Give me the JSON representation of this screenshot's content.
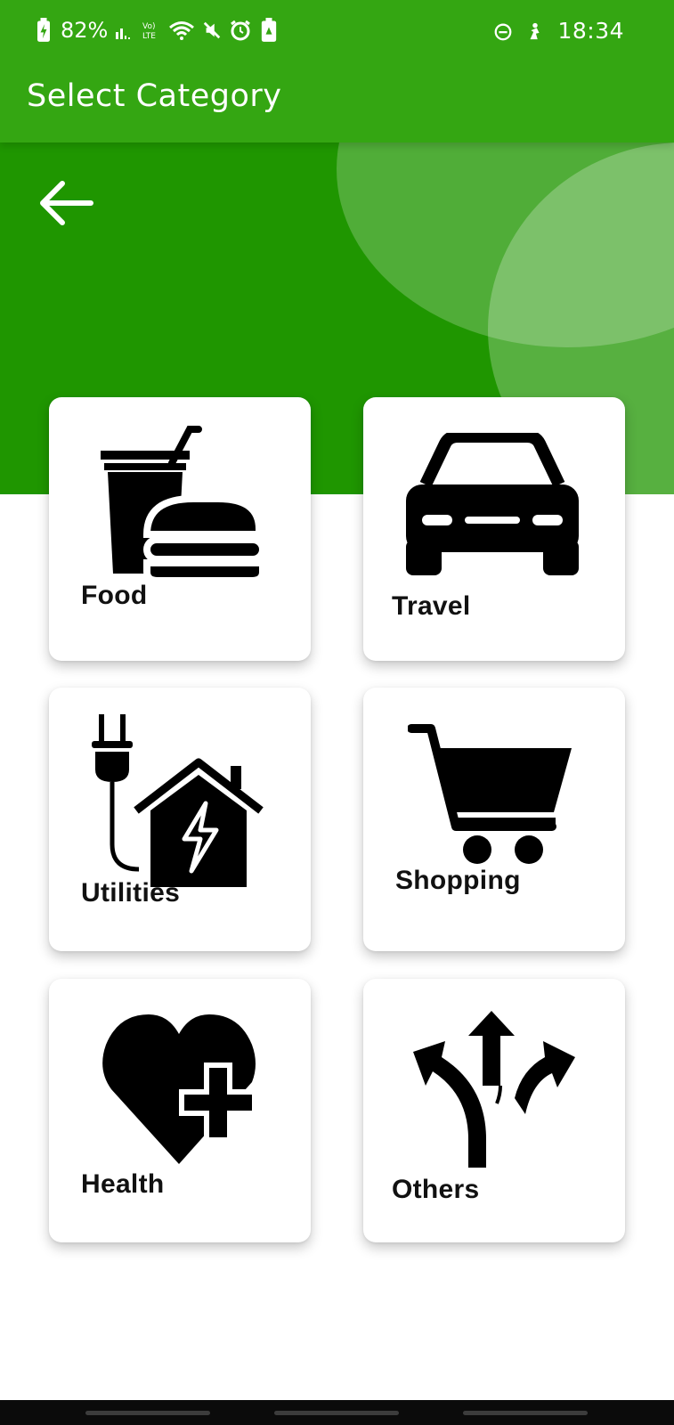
{
  "status_bar": {
    "battery": "82%",
    "time": "18:34"
  },
  "app_bar": {
    "title": "Select Category"
  },
  "categories": [
    {
      "label": "Food",
      "icon": "food-icon"
    },
    {
      "label": "Travel",
      "icon": "car-icon"
    },
    {
      "label": "Utilities",
      "icon": "utilities-icon"
    },
    {
      "label": "Shopping",
      "icon": "shopping-cart-icon"
    },
    {
      "label": "Health",
      "icon": "health-heart-icon"
    },
    {
      "label": "Others",
      "icon": "split-arrows-icon"
    }
  ],
  "colors": {
    "appbar": "#34a612",
    "header": "#1f9600",
    "card": "#ffffff"
  }
}
